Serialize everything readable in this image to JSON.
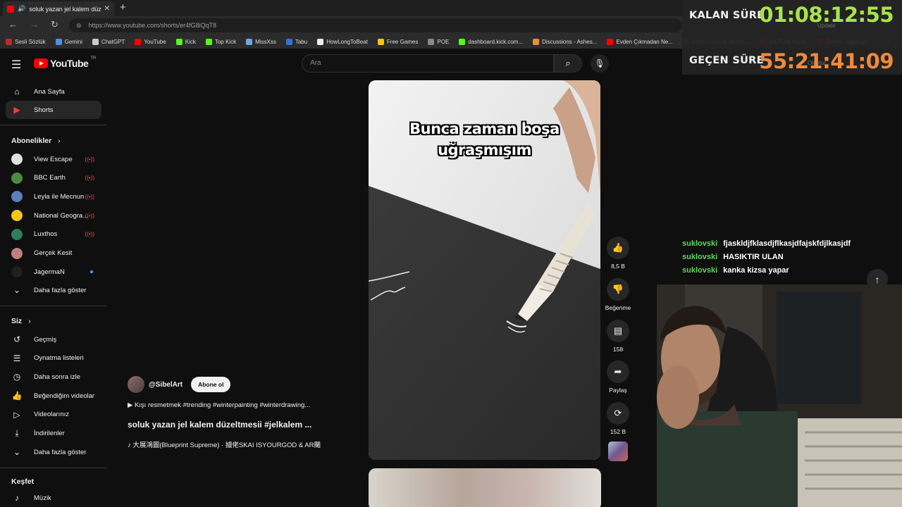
{
  "browser": {
    "tab_title": "soluk yazan jel kalem düzelt",
    "url": "https://www.youtube.com/shorts/er4fG8iQqT8",
    "bookmarks": [
      {
        "label": "Sesli Sözlük",
        "color": "#c62828"
      },
      {
        "label": "Gemini",
        "color": "#4a90e2"
      },
      {
        "label": "ChatGPT",
        "color": "#cccccc"
      },
      {
        "label": "YouTube",
        "color": "#ff0000"
      },
      {
        "label": "Kick",
        "color": "#53fc18"
      },
      {
        "label": "Top Kick",
        "color": "#53fc18"
      },
      {
        "label": "MissXss",
        "color": "#6fa8dc"
      },
      {
        "label": "Tabu",
        "color": "#3a6fd8"
      },
      {
        "label": "HowLongToBeat",
        "color": "#eeeeee"
      },
      {
        "label": "Free Games",
        "color": "#f5c518"
      },
      {
        "label": "POE",
        "color": "#888888"
      },
      {
        "label": "dashboard.kick.com...",
        "color": "#53fc18"
      },
      {
        "label": "Discussions - Ashes...",
        "color": "#e69138"
      },
      {
        "label": "Evden Çıkmadan Ne...",
        "color": "#ff0000"
      },
      {
        "label": "Aşkın Gücü 3. Sezon...",
        "color": "#ff0000"
      },
      {
        "label": "YouTube Music",
        "color": "#ff0000"
      },
      {
        "label": "Demet Sağıroğlu -...",
        "color": "#ff0000"
      }
    ]
  },
  "youtube": {
    "logo_text": "YouTube",
    "country_code": "TR",
    "search_placeholder": "Ara",
    "nav": [
      {
        "label": "Ana Sayfa",
        "icon": "home-icon",
        "glyph": "⌂"
      },
      {
        "label": "Shorts",
        "icon": "shorts-icon",
        "glyph": "▶"
      }
    ],
    "subscriptions_title": "Abonelikler",
    "subscriptions": [
      {
        "label": "View Escape",
        "color": "#e0e0e0",
        "status": "live"
      },
      {
        "label": "BBC Earth",
        "color": "#4c8c3f",
        "status": "live"
      },
      {
        "label": "Leyla ile Mecnun",
        "color": "#5b7fb8",
        "status": "live"
      },
      {
        "label": "National Geogra...",
        "color": "#f5c518",
        "status": "live"
      },
      {
        "label": "Luxthos",
        "color": "#2e7d5b",
        "status": "live"
      },
      {
        "label": "Gerçek Kesit",
        "color": "#c08080",
        "status": ""
      },
      {
        "label": "JagermaN",
        "color": "#202020",
        "status": "new"
      }
    ],
    "show_more": "Daha fazla göster",
    "you_title": "Siz",
    "you_items": [
      {
        "label": "Geçmiş",
        "icon": "history-icon",
        "glyph": "↺"
      },
      {
        "label": "Oynatma listeleri",
        "icon": "playlists-icon",
        "glyph": "☰"
      },
      {
        "label": "Daha sonra izle",
        "icon": "watch-later-icon",
        "glyph": "◷"
      },
      {
        "label": "Beğendiğim videolar",
        "icon": "liked-videos-icon",
        "glyph": "👍"
      },
      {
        "label": "Videolarınız",
        "icon": "your-videos-icon",
        "glyph": "▷"
      },
      {
        "label": "İndirilenler",
        "icon": "downloads-icon",
        "glyph": "⤓"
      }
    ],
    "you_show_more": "Daha fazla göster",
    "explore_title": "Keşfet",
    "explore_items": [
      {
        "label": "Müzik",
        "icon": "music-icon",
        "glyph": "♪"
      }
    ]
  },
  "short": {
    "overlay_line1": "Bunca zaman boşa",
    "overlay_line2": "uğraşmışım",
    "channel": "@SibelArt",
    "subscribe": "Abone ol",
    "description": "▶ Kışı resmetmek #trending #winterpainting #winterdrawing...",
    "title": "soluk yazan jel kalem düzeltmesii #jelkalem ...",
    "sound": "♪ 大展鴻圖(Blueprint Supreme) · 擄佬SKAI ISYOURGOD & AR颺",
    "likes": "8,5 B",
    "dislike": "Beğenme",
    "comments": "158",
    "share": "Paylaş",
    "remix": "152 B"
  },
  "overlay": {
    "remaining_label": "KALAN SÜRE",
    "remaining_value": "01:08:12:55",
    "elapsed_label": "GEÇEN SÜRE",
    "elapsed_value": "55:21:41:09",
    "remaining_color": "#a9e34b",
    "elapsed_color": "#f08a3c",
    "ghost_update": "Update",
    "ghost_olustur": "Oluştur"
  },
  "chat": [
    {
      "user": "suklovski",
      "message": "fjaskldjfklasdjflkasjdfajskfdjlkasjdf"
    },
    {
      "user": "suklovski",
      "message": "HASIKTIR ULAN"
    },
    {
      "user": "suklovski",
      "message": "kanka kizsa yapar"
    }
  ]
}
